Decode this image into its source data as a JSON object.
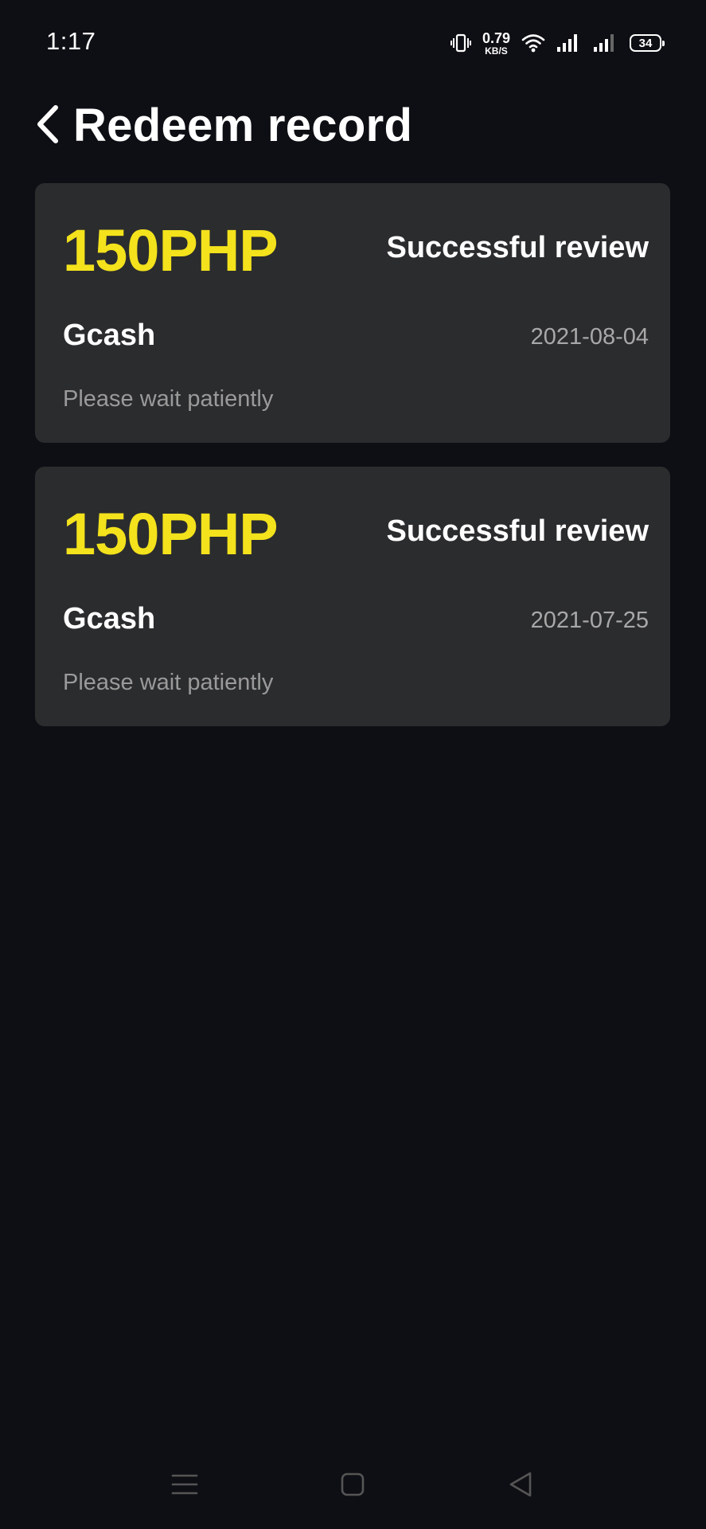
{
  "status_bar": {
    "time": "1:17",
    "net_speed_value": "0.79",
    "net_speed_unit": "KB/S",
    "battery_level": "34",
    "icons": [
      "vibrate-icon",
      "wifi-icon",
      "signal-icon-sim1",
      "signal-icon-sim2",
      "battery-icon"
    ]
  },
  "header": {
    "back_icon": "chevron-left-icon",
    "title": "Redeem record"
  },
  "records": [
    {
      "amount": "150PHP",
      "status": "Successful review",
      "method": "Gcash",
      "date": "2021-08-04",
      "note": "Please wait patiently"
    },
    {
      "amount": "150PHP",
      "status": "Successful review",
      "method": "Gcash",
      "date": "2021-07-25",
      "note": "Please wait patiently"
    }
  ],
  "nav_bar": {
    "icons": [
      "menu-icon",
      "home-icon",
      "back-triangle-icon"
    ]
  },
  "colors": {
    "background": "#0e0f14",
    "card": "#2b2c2e",
    "amount_accent": "#f3e21c",
    "primary_text": "#ffffff",
    "secondary_text": "#9a9a9a"
  }
}
